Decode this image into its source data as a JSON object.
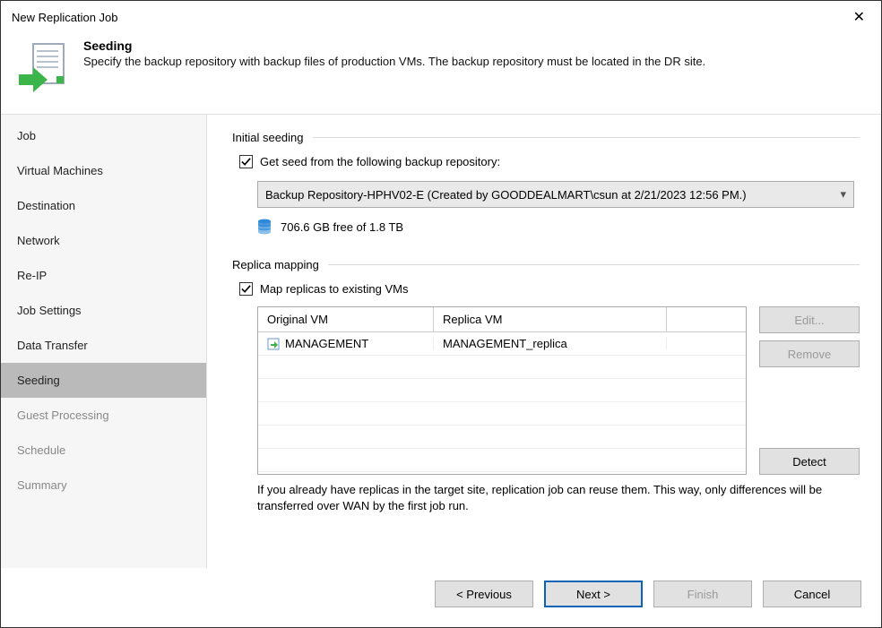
{
  "window": {
    "title": "New Replication Job"
  },
  "header": {
    "title": "Seeding",
    "subtitle": "Specify the backup repository with backup files of production VMs. The backup repository must be located in the DR site."
  },
  "sidebar": {
    "items": [
      {
        "label": "Job"
      },
      {
        "label": "Virtual Machines"
      },
      {
        "label": "Destination"
      },
      {
        "label": "Network"
      },
      {
        "label": "Re-IP"
      },
      {
        "label": "Job Settings"
      },
      {
        "label": "Data Transfer"
      },
      {
        "label": "Seeding"
      },
      {
        "label": "Guest Processing"
      },
      {
        "label": "Schedule"
      },
      {
        "label": "Summary"
      }
    ],
    "active_index": 7
  },
  "initial_seeding": {
    "legend": "Initial seeding",
    "checkbox_label": "Get seed from the following backup repository:",
    "checked": true,
    "dropdown_value": "Backup Repository-HPHV02-E (Created by GOODDEALMART\\csun at 2/21/2023 12:56 PM.)",
    "storage_text": "706.6 GB free of 1.8 TB"
  },
  "replica_mapping": {
    "legend": "Replica mapping",
    "checkbox_label": "Map replicas to existing VMs",
    "checked": true,
    "columns": [
      "Original VM",
      "Replica VM"
    ],
    "rows": [
      {
        "original": "MANAGEMENT",
        "replica": "MANAGEMENT_replica"
      }
    ],
    "buttons": {
      "edit": "Edit...",
      "remove": "Remove",
      "detect": "Detect"
    },
    "help": "If you already have replicas in the target site, replication job can reuse them. This way, only differences will be transferred over WAN by the first job run."
  },
  "footer": {
    "previous": "< Previous",
    "next": "Next >",
    "finish": "Finish",
    "cancel": "Cancel"
  }
}
